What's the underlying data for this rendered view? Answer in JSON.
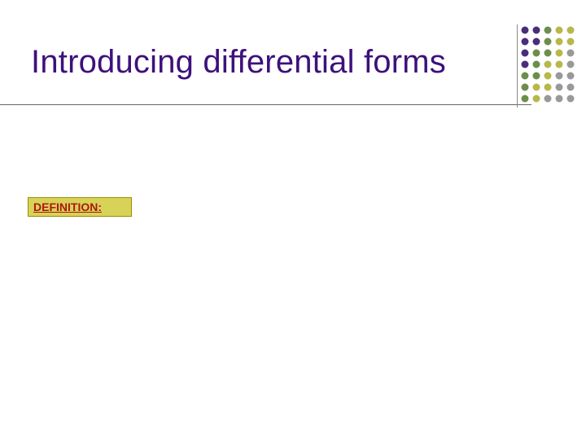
{
  "slide": {
    "title": "Introducing differential forms",
    "definition_label": "DEFINITION:"
  },
  "decoration": {
    "type": "dot-grid",
    "rows": 7,
    "cols": 5,
    "palette": [
      "#4a2d7a",
      "#6b8f4a",
      "#b8b84a",
      "#999999"
    ]
  }
}
